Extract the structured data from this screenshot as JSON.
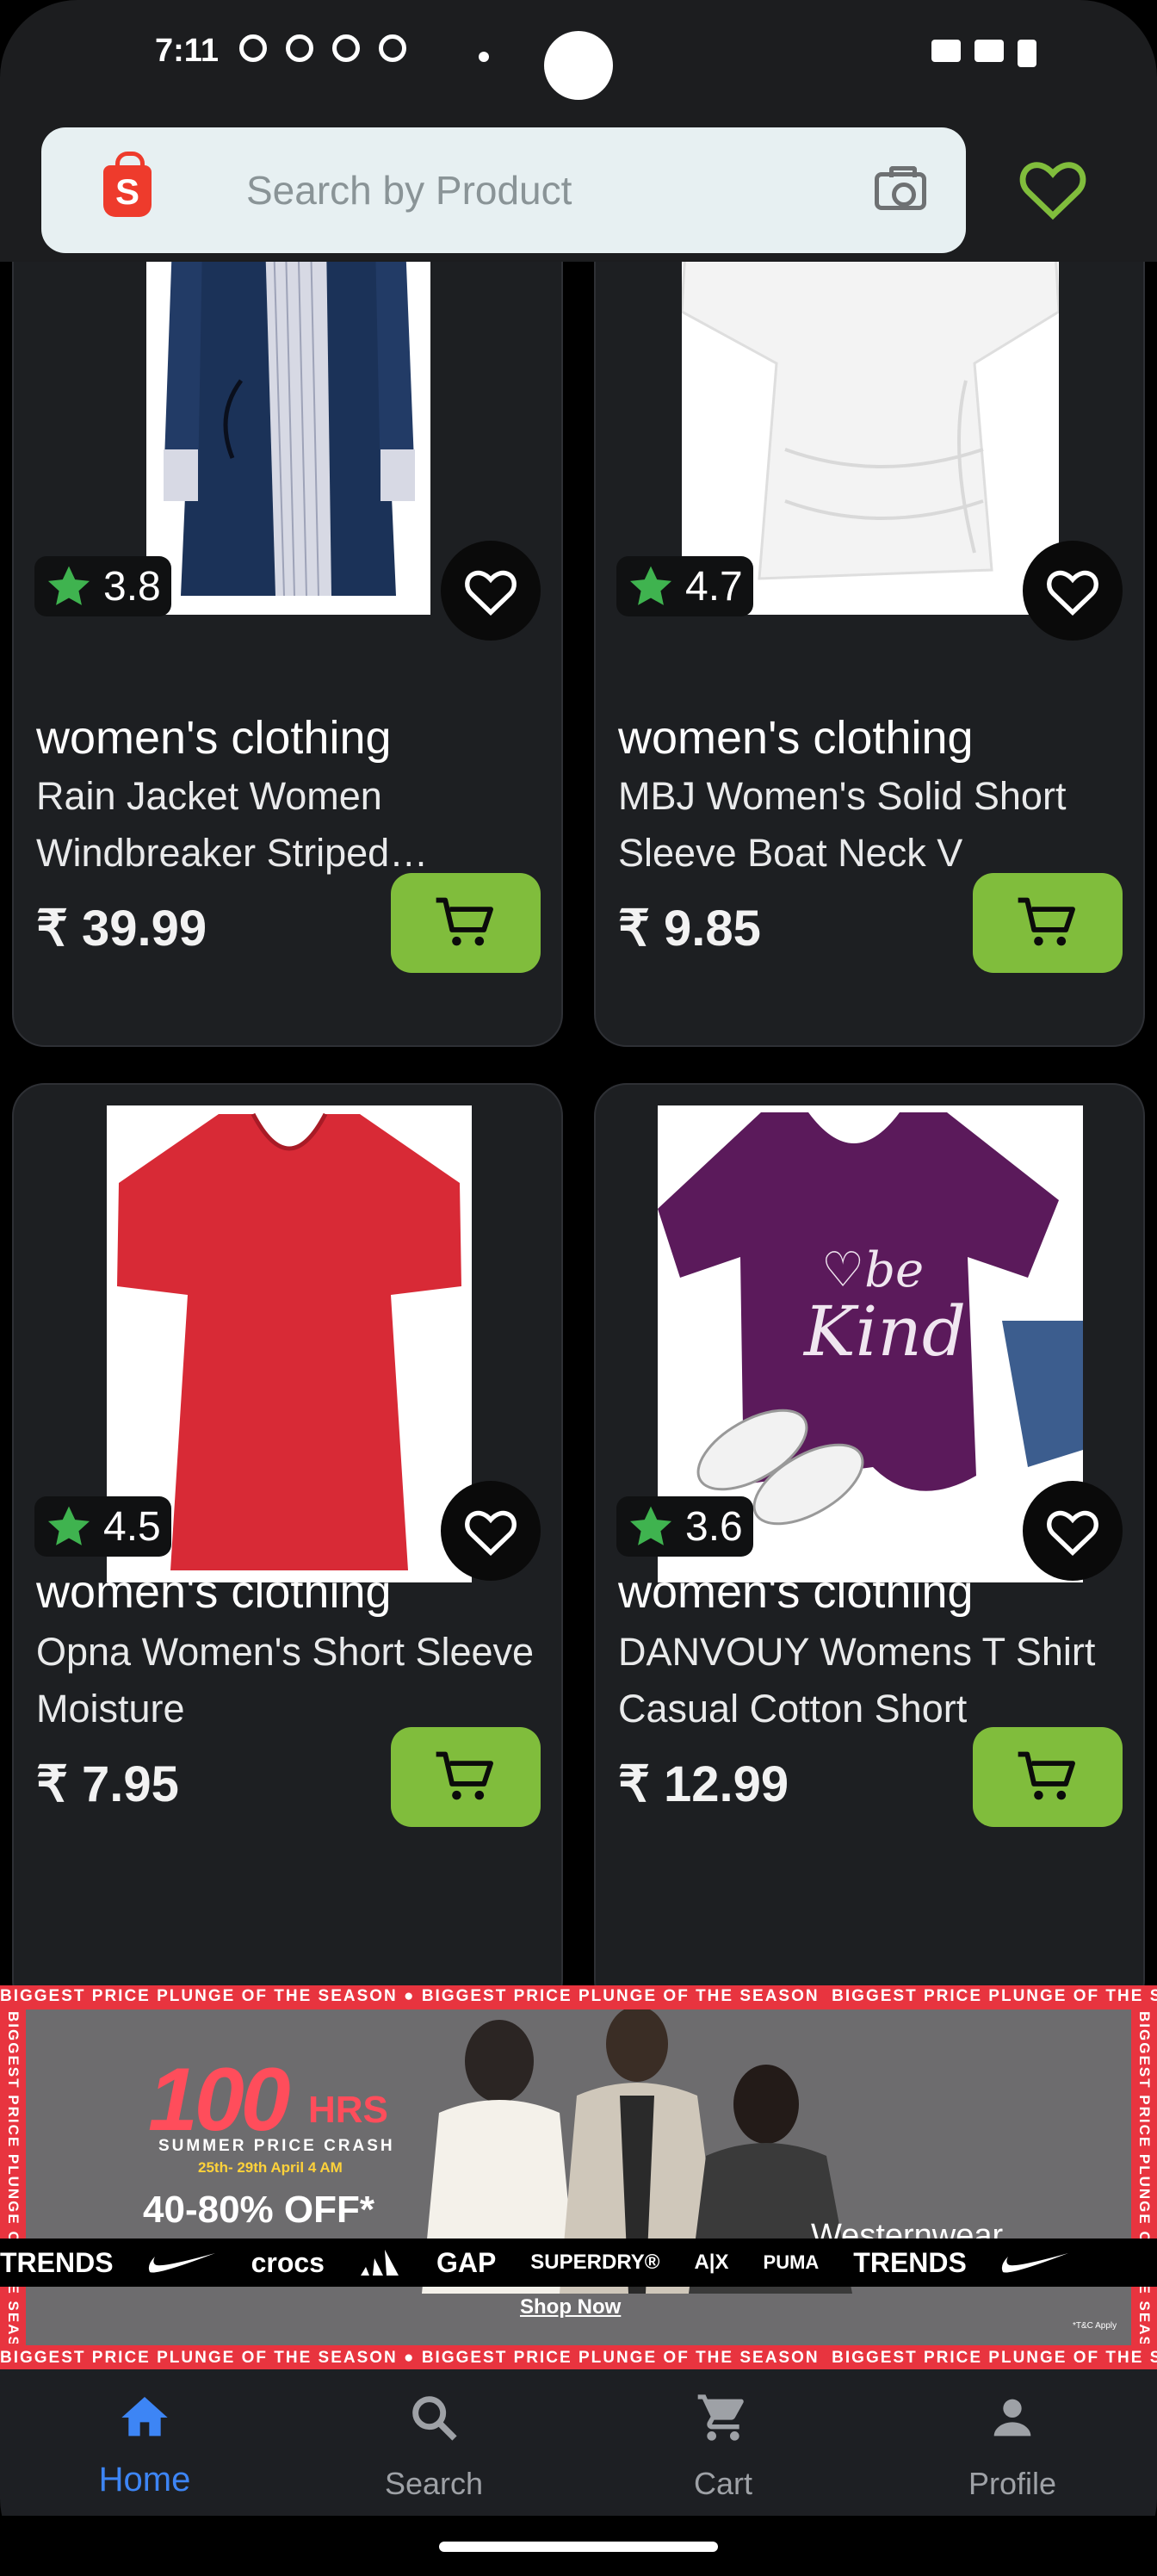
{
  "status_bar": {
    "time": "7:11"
  },
  "header": {
    "search_placeholder": "Search by Product",
    "logo_letter": "S",
    "icons": [
      "shop-logo-icon",
      "camera-icon",
      "heart-outline-icon"
    ],
    "accent_color": "#80bd3c"
  },
  "products": [
    {
      "rating": "3.8",
      "category": "women's clothing",
      "title": "Rain Jacket Women Windbreaker Striped Climbing Raincoats",
      "price": "₹ 39.99"
    },
    {
      "rating": "4.7",
      "category": "women's clothing",
      "title": "MBJ Women's Solid Short Sleeve Boat Neck V",
      "price": "₹ 9.85"
    },
    {
      "rating": "4.5",
      "category": "women's clothing",
      "title": "Opna Women's Short Sleeve Moisture",
      "price": "₹ 7.95"
    },
    {
      "rating": "3.6",
      "category": "women's clothing",
      "title": "DANVOUY Womens T Shirt Casual Cotton Short",
      "price": "₹ 12.99"
    }
  ],
  "banner": {
    "strip_text": "BIGGEST PRICE PLUNGE OF THE SEASON",
    "headline_number": "100",
    "headline_unit": "HRS",
    "subheadline": "SUMMER PRICE CRASH",
    "dates": "25th- 29th April 4 AM",
    "discount": "40-80% OFF*",
    "category": "Westernwear",
    "brands": [
      "TRENDS",
      "crocs",
      "GAP",
      "SUPERDRY®",
      "A|X",
      "PUMA",
      "TRENDS"
    ],
    "cta": "Shop Now",
    "fine_print": "*T&C Apply"
  },
  "bottom_nav": {
    "items": [
      {
        "label": "Home",
        "icon": "home-icon",
        "active": true
      },
      {
        "label": "Search",
        "icon": "search-icon",
        "active": false
      },
      {
        "label": "Cart",
        "icon": "cart-icon",
        "active": false
      },
      {
        "label": "Profile",
        "icon": "profile-icon",
        "active": false
      }
    ],
    "active_color": "#3d85f5"
  }
}
